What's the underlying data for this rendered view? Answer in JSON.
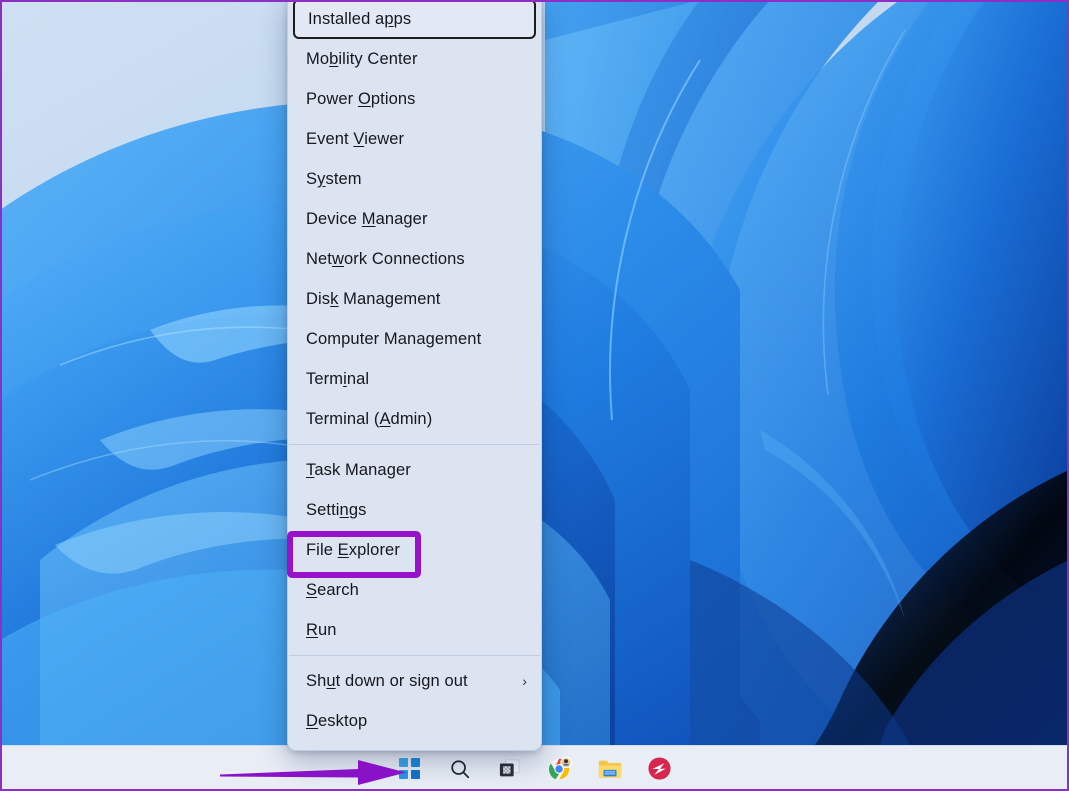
{
  "window": {
    "title": "Windows 11 Desktop — Power User (WinX) Menu",
    "annotation_color": "#9712c9",
    "arrow_color": "#8a12c6"
  },
  "desktop": {
    "wallpaper_name": "windows-11-bloom-wallpaper",
    "colors": {
      "sky": "#c6dcf2",
      "ribbon_light": "#45a6f5",
      "ribbon_mid": "#1f74e0",
      "ribbon_deep": "#0b3fa8",
      "ribbon_darkest": "#071f5e"
    }
  },
  "winx_menu": {
    "name": "Power User menu",
    "background": "#dce3f1",
    "groups": [
      {
        "items": [
          {
            "label": "Installed apps",
            "pre": "Installed a",
            "key": "p",
            "post": "ps",
            "focused": true,
            "submenu": false
          },
          {
            "label": "Mobility Center",
            "pre": "Mo",
            "key": "b",
            "post": "ility Center",
            "focused": false,
            "submenu": false
          },
          {
            "label": "Power Options",
            "pre": "Power ",
            "key": "O",
            "post": "ptions",
            "focused": false,
            "submenu": false
          },
          {
            "label": "Event Viewer",
            "pre": "Event ",
            "key": "V",
            "post": "iewer",
            "focused": false,
            "submenu": false
          },
          {
            "label": "System",
            "pre": "S",
            "key": "y",
            "post": "stem",
            "focused": false,
            "submenu": false
          },
          {
            "label": "Device Manager",
            "pre": "Device ",
            "key": "M",
            "post": "anager",
            "focused": false,
            "submenu": false
          },
          {
            "label": "Network Connections",
            "pre": "Net",
            "key": "w",
            "post": "ork Connections",
            "focused": false,
            "submenu": false
          },
          {
            "label": "Disk Management",
            "pre": "Dis",
            "key": "k",
            "post": " Management",
            "focused": false,
            "submenu": false
          },
          {
            "label": "Computer Management",
            "pre": "Computer Mana",
            "key": "g",
            "post": "ement",
            "focused": false,
            "submenu": false
          },
          {
            "label": "Terminal",
            "pre": "Term",
            "key": "i",
            "post": "nal",
            "focused": false,
            "submenu": false
          },
          {
            "label": "Terminal (Admin)",
            "pre": "Terminal (",
            "key": "A",
            "post": "dmin)",
            "focused": false,
            "submenu": false
          }
        ]
      },
      {
        "items": [
          {
            "label": "Task Manager",
            "pre": "",
            "key": "T",
            "post": "ask Manager",
            "focused": false,
            "submenu": false
          },
          {
            "label": "Settings",
            "pre": "Setti",
            "key": "n",
            "post": "gs",
            "focused": false,
            "submenu": false
          },
          {
            "label": "File Explorer",
            "pre": "File ",
            "key": "E",
            "post": "xplorer",
            "focused": false,
            "submenu": false,
            "highlighted": true
          },
          {
            "label": "Search",
            "pre": "",
            "key": "S",
            "post": "earch",
            "focused": false,
            "submenu": false
          },
          {
            "label": "Run",
            "pre": "",
            "key": "R",
            "post": "un",
            "focused": false,
            "submenu": false
          }
        ]
      },
      {
        "items": [
          {
            "label": "Shut down or sign out",
            "pre": "Sh",
            "key": "u",
            "post": "t down or sign out",
            "focused": false,
            "submenu": true,
            "submenu_glyph": "›"
          },
          {
            "label": "Desktop",
            "pre": "",
            "key": "D",
            "post": "esktop",
            "focused": false,
            "submenu": false
          }
        ]
      }
    ]
  },
  "taskbar": {
    "background": "#e8edf6",
    "icons": [
      {
        "name": "start-button",
        "label": "Start"
      },
      {
        "name": "search-icon",
        "label": "Search"
      },
      {
        "name": "task-view-icon",
        "label": "Task view"
      },
      {
        "name": "chrome-icon",
        "label": "Google Chrome"
      },
      {
        "name": "file-explorer-icon",
        "label": "File Explorer"
      },
      {
        "name": "app-icon-red",
        "label": "App"
      }
    ]
  }
}
